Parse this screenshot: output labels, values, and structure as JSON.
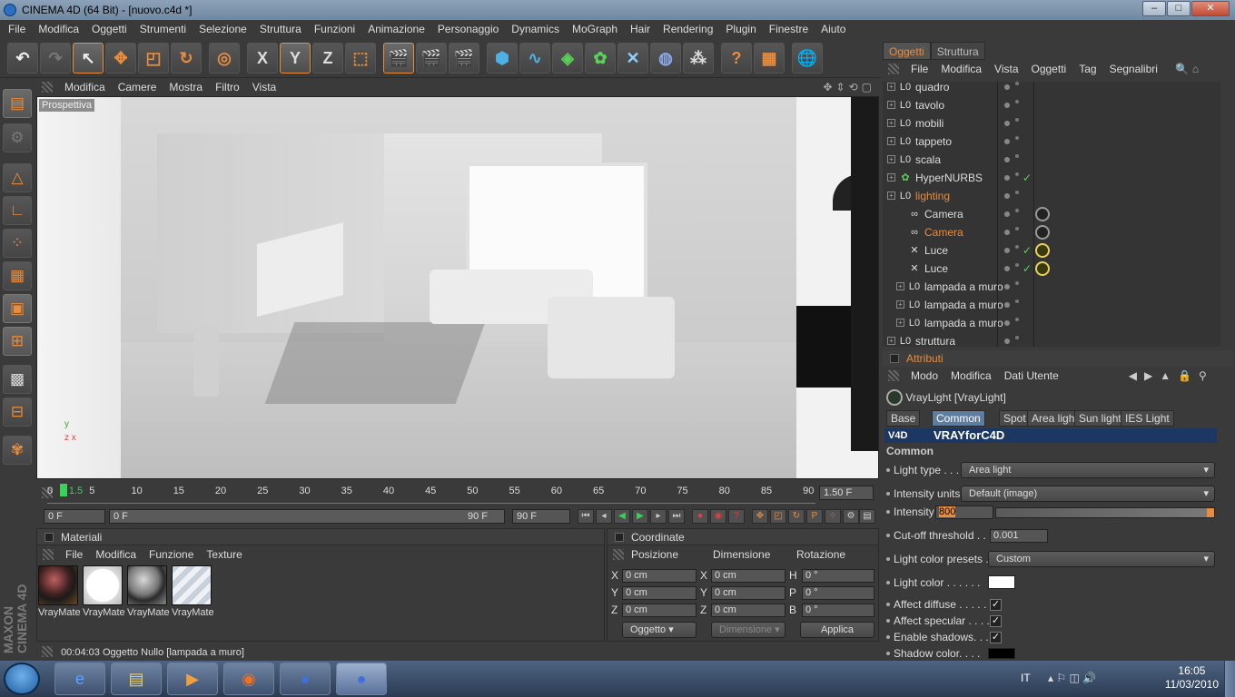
{
  "window": {
    "title": "CINEMA 4D (64 Bit) - [nuovo.c4d *]",
    "buttons": [
      "–",
      "□",
      "✕"
    ]
  },
  "menubar": [
    "File",
    "Modifica",
    "Oggetti",
    "Strumenti",
    "Selezione",
    "Struttura",
    "Funzioni",
    "Animazione",
    "Personaggio",
    "Dynamics",
    "MoGraph",
    "Hair",
    "Rendering",
    "Plugin",
    "Finestre",
    "Aiuto"
  ],
  "toolbar": {
    "icons": [
      "undo-icon",
      "redo-icon",
      "move-cursor-icon",
      "move-icon",
      "scale-icon",
      "rotate-icon",
      "live-select-icon",
      "x-axis",
      "y-axis",
      "z-axis",
      "world-coord-icon",
      "render-view-icon",
      "render-picture-viewer-icon",
      "render-settings-icon",
      "cube-icon",
      "spline-icon",
      "nurbs-icon",
      "array-icon",
      "deformer-icon",
      "environment-icon",
      "particles-icon",
      "help-icon",
      "layer-icon",
      "web-icon"
    ],
    "axis_labels": [
      "X",
      "Y",
      "Z"
    ]
  },
  "viewport": {
    "menu": [
      "Modifica",
      "Camere",
      "Mostra",
      "Filtro",
      "Vista"
    ],
    "label": "Prospettiva"
  },
  "timeline": {
    "ticks": [
      "0",
      "1.5",
      "5",
      "10",
      "15",
      "20",
      "25",
      "30",
      "35",
      "40",
      "45",
      "50",
      "55",
      "60",
      "65",
      "70",
      "75",
      "80",
      "85",
      "90"
    ],
    "current_frame": "1.50 F",
    "start_field": "0 F",
    "range_start": "0 F",
    "range_end": "90 F",
    "end_field": "90 F"
  },
  "materials": {
    "title": "Materiali",
    "menu": [
      "File",
      "Modifica",
      "Funzione",
      "Texture"
    ],
    "items": [
      {
        "label": "VrayMate"
      },
      {
        "label": "VrayMate"
      },
      {
        "label": "VrayMate"
      },
      {
        "label": "VrayMate"
      }
    ]
  },
  "coords": {
    "title": "Coordinate",
    "headers": [
      "Posizione",
      "Dimensione",
      "Rotazione"
    ],
    "rows": [
      {
        "a1": "X",
        "v1": "0 cm",
        "a2": "X",
        "v2": "0 cm",
        "a3": "H",
        "v3": "0 °"
      },
      {
        "a1": "Y",
        "v1": "0 cm",
        "a2": "Y",
        "v2": "0 cm",
        "a3": "P",
        "v3": "0 °"
      },
      {
        "a1": "Z",
        "v1": "0 cm",
        "a2": "Z",
        "v2": "0 cm",
        "a3": "B",
        "v3": "0 °"
      }
    ],
    "mode": "Oggetto",
    "size_mode": "Dimensione",
    "apply": "Applica"
  },
  "status": {
    "time": "00:04:03",
    "text": "Oggetto Nullo [lampada a muro]"
  },
  "objects_panel": {
    "tabs": [
      "Oggetti",
      "Struttura"
    ],
    "menu": [
      "File",
      "Modifica",
      "Vista",
      "Oggetti",
      "Tag",
      "Segnalibri"
    ],
    "rows": [
      {
        "name": "quadro",
        "icon": "null-icon",
        "level": 0
      },
      {
        "name": "tavolo",
        "icon": "null-icon",
        "level": 0
      },
      {
        "name": "mobili",
        "icon": "null-icon",
        "level": 0
      },
      {
        "name": "tappeto",
        "icon": "null-icon",
        "level": 0
      },
      {
        "name": "scala",
        "icon": "null-icon",
        "level": 0
      },
      {
        "name": "HyperNURBS",
        "icon": "hypernurbs-icon",
        "level": 0
      },
      {
        "name": "lighting",
        "icon": "null-icon",
        "level": 0,
        "highlight": true
      },
      {
        "name": "Camera",
        "icon": "camera-icon",
        "level": 1
      },
      {
        "name": "Camera",
        "icon": "camera-icon",
        "level": 1,
        "highlight": true
      },
      {
        "name": "Luce",
        "icon": "light-icon",
        "level": 1
      },
      {
        "name": "Luce",
        "icon": "light-icon",
        "level": 1
      },
      {
        "name": "lampada a muro",
        "icon": "null-icon",
        "level": 1
      },
      {
        "name": "lampada a muro",
        "icon": "null-icon",
        "level": 1
      },
      {
        "name": "lampada a muro",
        "icon": "null-icon",
        "level": 1
      },
      {
        "name": "struttura",
        "icon": "null-icon",
        "level": 0
      }
    ]
  },
  "attributes": {
    "title": "Attributi",
    "menu": [
      "Modo",
      "Modifica",
      "Dati Utente"
    ],
    "object": "VrayLight [VrayLight]",
    "tabs": [
      "Base",
      "Common",
      "Spot light",
      "Area light",
      "Sun light",
      "IES Light"
    ],
    "active_tab": "Common",
    "banner": "VRAYforC4D",
    "banner_logo": "V4D",
    "section": "Common",
    "light_type_label": "Light type . . .",
    "light_type": "Area light",
    "intensity_units_label": "Intensity units",
    "intensity_units": "Default (image)",
    "intensity_label": "Intensity",
    "intensity": "800",
    "cutoff_label": "Cut-off threshold . . . .",
    "cutoff": "0.001",
    "presets_label": "Light color presets . .",
    "presets": "Custom",
    "color_label": "Light color . . . . . .",
    "affect_diffuse": "Affect diffuse . . . . . .",
    "affect_specular": "Affect specular . . . .",
    "enable_shadows": "Enable shadows. . . .",
    "shadow_color": "Shadow color. . . ."
  },
  "taskbar": {
    "lang": "IT",
    "time": "16:05",
    "date": "11/03/2010"
  },
  "colors": {
    "accent": "#e98c3b",
    "vray_blue": "#1b3762",
    "tab_active": "#5f7da1"
  }
}
